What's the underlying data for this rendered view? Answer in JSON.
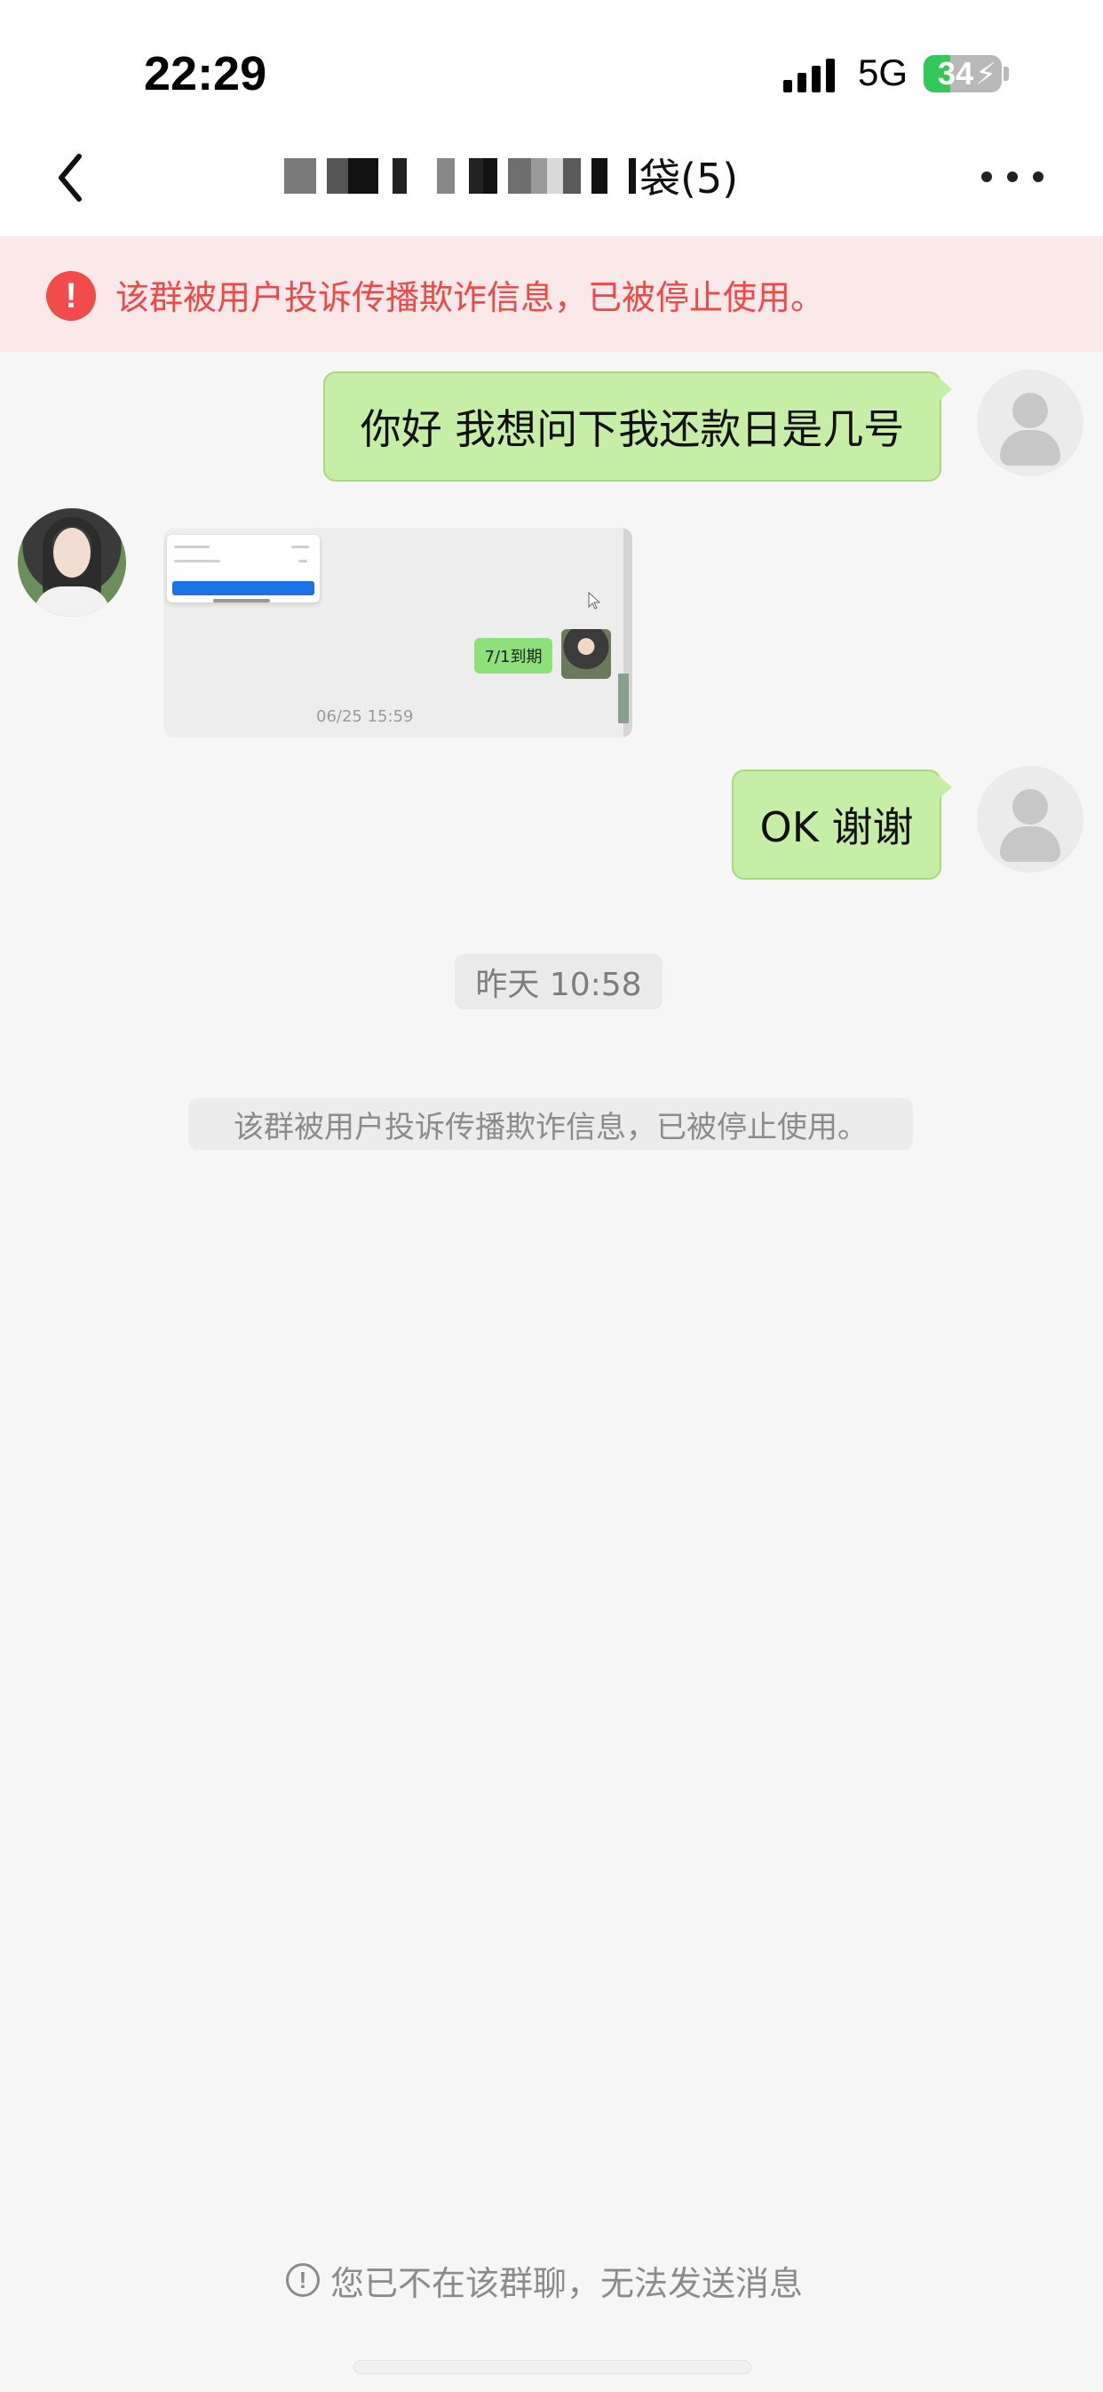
{
  "status_bar": {
    "time": "22:29",
    "network": "5G",
    "battery_percent": 34,
    "battery_text": "34",
    "battery_icon": "charging-bolt-icon"
  },
  "nav": {
    "back_icon": "chevron-left-icon",
    "title_suffix": "袋(5)",
    "more_icon": "ellipsis-icon"
  },
  "banner": {
    "text": "该群被用户投诉传播欺诈信息，已被停止使用。",
    "icon": "alert-circle-icon",
    "accent_color": "#f04747"
  },
  "messages": [
    {
      "type": "outgoing_text",
      "text": "你好 我想问下我还款日是几号"
    },
    {
      "type": "incoming_image",
      "image_caption": "7/1到期",
      "image_timestamp": "06/25 15:59"
    },
    {
      "type": "outgoing_text",
      "text": "OK 谢谢"
    }
  ],
  "timeline": {
    "time_pill": "昨天 10:58",
    "system_note": "该群被用户投诉传播欺诈信息，已被停止使用。"
  },
  "footer": {
    "note": "您已不在该群聊，无法发送消息",
    "icon": "info-icon"
  }
}
